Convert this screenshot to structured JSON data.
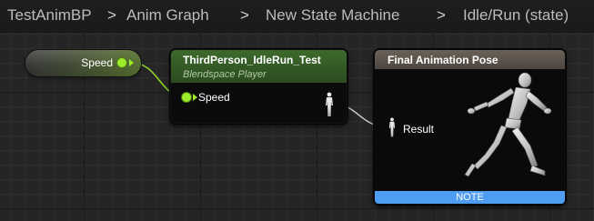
{
  "breadcrumb": {
    "items": [
      "TestAnimBP",
      "Anim Graph",
      "New State Machine",
      "Idle/Run (state)"
    ],
    "separator": ">"
  },
  "variable_node": {
    "label": "Speed",
    "pin_color": "#9dec2b"
  },
  "blendspace_node": {
    "title": "ThirdPerson_IdleRun_Test",
    "subtitle": "Blendspace Player",
    "input_pin_label": "Speed",
    "header_color": "#3d6a2b",
    "output_icon": "person-pose-icon"
  },
  "final_pose_node": {
    "title": "Final Animation Pose",
    "input_pin_label": "Result",
    "input_icon": "person-pose-icon",
    "preview_icon": "running-mannequin-icon",
    "note_label": "NOTE",
    "note_color": "#4f9cf3"
  }
}
